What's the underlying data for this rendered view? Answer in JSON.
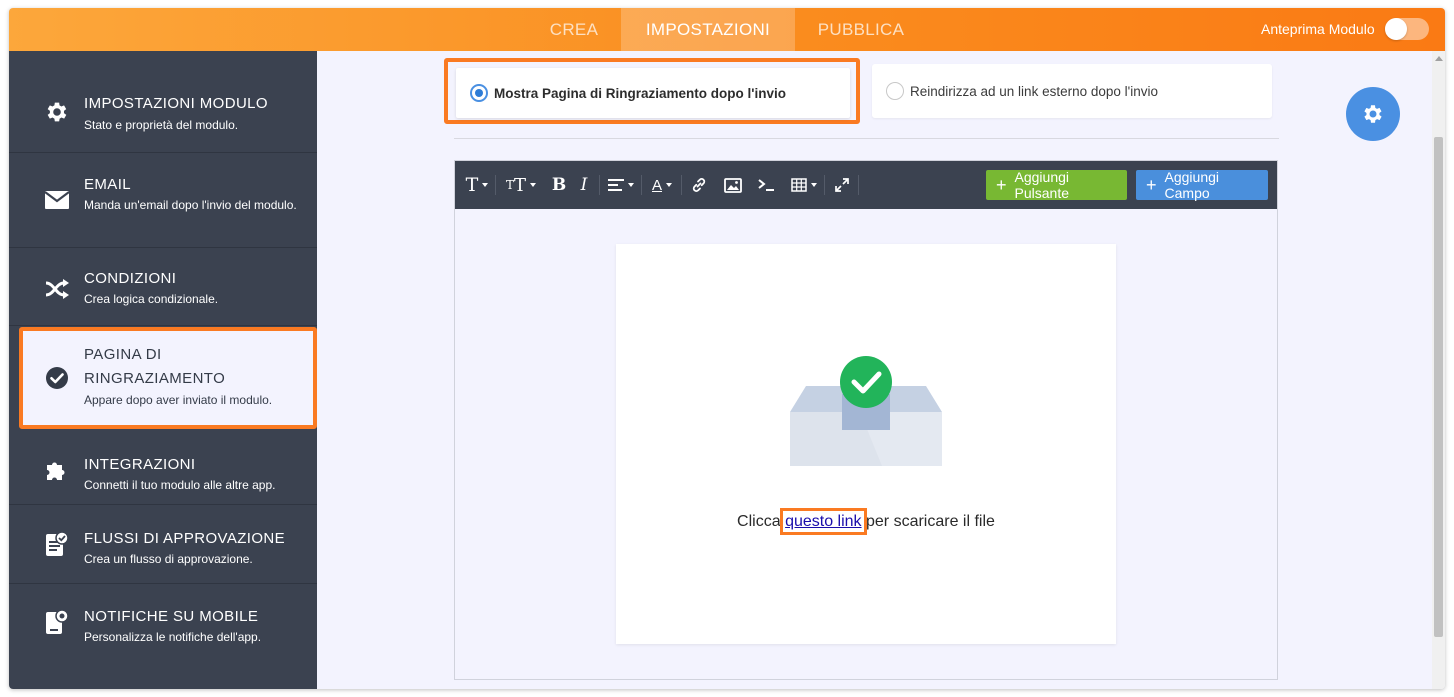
{
  "topbar": {
    "tabs": [
      {
        "label": "CREA",
        "active": false
      },
      {
        "label": "IMPOSTAZIONI",
        "active": true
      },
      {
        "label": "PUBBLICA",
        "active": false
      }
    ],
    "preview_label": "Anteprima Modulo",
    "preview_toggle_on": false
  },
  "sidebar": {
    "items": [
      {
        "title": "IMPOSTAZIONI MODULO",
        "desc": "Stato e proprietà del modulo.",
        "icon": "gear-icon"
      },
      {
        "title": "EMAIL",
        "desc": "Manda un'email dopo l'invio del modulo.",
        "icon": "envelope-icon"
      },
      {
        "title": "CONDIZIONI",
        "desc": "Crea logica condizionale.",
        "icon": "shuffle-icon"
      },
      {
        "title": "PAGINA DI RINGRAZIAMENTO",
        "desc": "Appare dopo aver inviato il modulo.",
        "icon": "check-circle-icon",
        "active": true
      },
      {
        "title": "INTEGRAZIONI",
        "desc": "Connetti il tuo modulo alle altre app.",
        "icon": "puzzle-icon"
      },
      {
        "title": "FLUSSI DI APPROVAZIONE",
        "desc": "Crea un flusso di approvazione.",
        "icon": "approval-doc-icon"
      },
      {
        "title": "NOTIFICHE SU MOBILE",
        "desc": "Personalizza le notifiche dell'app.",
        "icon": "mobile-notification-icon"
      }
    ]
  },
  "options": {
    "thank_you_page": {
      "label": "Mostra Pagina di Ringraziamento dopo l'invio",
      "selected": true
    },
    "redirect": {
      "label": "Reindirizza ad un link esterno dopo l'invio",
      "selected": false
    }
  },
  "editor": {
    "toolbar": {
      "tools": [
        "font-icon",
        "font-size-icon",
        "bold-icon",
        "italic-icon",
        "align-icon",
        "text-color-icon",
        "link-icon",
        "image-icon",
        "code-icon",
        "table-icon",
        "fullscreen-icon"
      ],
      "add_button_label": "Aggiungi Pulsante",
      "add_field_label": "Aggiungi Campo"
    },
    "content": {
      "illustration": "inbox-check-icon",
      "text_before": "Clicca ",
      "link_text": "questo link",
      "text_after": " per scaricare il file"
    }
  },
  "colors": {
    "accent_orange": "#fa7a22",
    "sidebar_bg": "#3b4250",
    "primary_blue": "#4a90e2",
    "green": "#78b833",
    "check_green": "#22b45a"
  }
}
